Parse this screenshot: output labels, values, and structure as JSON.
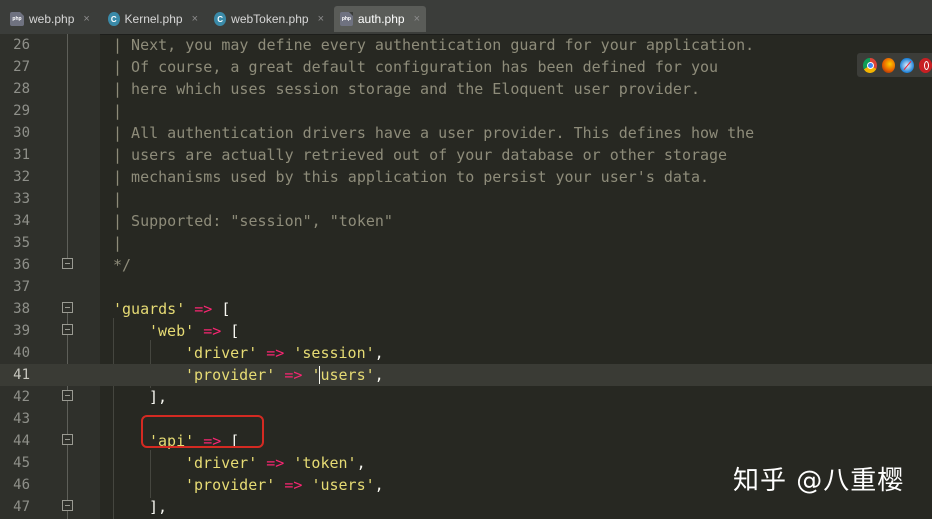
{
  "tabs": [
    {
      "name": "web.php",
      "icon": "php-file-icon",
      "active": false
    },
    {
      "name": "Kernel.php",
      "icon": "class-file-icon",
      "active": false
    },
    {
      "name": "webToken.php",
      "icon": "class-file-icon",
      "active": false
    },
    {
      "name": "auth.php",
      "icon": "php-file-icon",
      "active": true
    }
  ],
  "tab_close_glyph": "×",
  "editor": {
    "current_line": "41",
    "lines": [
      {
        "num": "26",
        "text": "| Next, you may define every authentication guard for your application."
      },
      {
        "num": "27",
        "text": "| Of course, a great default configuration has been defined for you"
      },
      {
        "num": "28",
        "text": "| here which uses session storage and the Eloquent user provider."
      },
      {
        "num": "29",
        "text": "|"
      },
      {
        "num": "30",
        "text": "| All authentication drivers have a user provider. This defines how the"
      },
      {
        "num": "31",
        "text": "| users are actually retrieved out of your database or other storage"
      },
      {
        "num": "32",
        "text": "| mechanisms used by this application to persist your user's data."
      },
      {
        "num": "33",
        "text": "|"
      },
      {
        "num": "34",
        "text": "| Supported: \"session\", \"token\""
      },
      {
        "num": "35",
        "text": "|"
      },
      {
        "num": "36",
        "text": "*/"
      },
      {
        "num": "37",
        "text": ""
      },
      {
        "num": "38",
        "key": "'guards'",
        "op": "=>",
        "tail": "["
      },
      {
        "num": "39",
        "key": "'web'",
        "op": "=>",
        "tail": "["
      },
      {
        "num": "40",
        "key": "'driver'",
        "op": "=>",
        "val": "'session'",
        "tail": ","
      },
      {
        "num": "41",
        "key": "'provider'",
        "op": "=>",
        "val": "'users'",
        "tail": ","
      },
      {
        "num": "42",
        "tail": "],"
      },
      {
        "num": "43",
        "text": ""
      },
      {
        "num": "44",
        "key": "'api'",
        "op": "=>",
        "tail": "["
      },
      {
        "num": "45",
        "key": "'driver'",
        "op": "=>",
        "val": "'token'",
        "tail": ","
      },
      {
        "num": "46",
        "key": "'provider'",
        "op": "=>",
        "val": "'users'",
        "tail": ","
      },
      {
        "num": "47",
        "tail": "],"
      }
    ]
  },
  "browser_icons": [
    "chrome-icon",
    "firefox-icon",
    "safari-icon",
    "opera-icon"
  ],
  "watermark": "知乎 @八重樱",
  "colors": {
    "background": "#272822",
    "comment": "#8e8c7a",
    "string": "#e6db74",
    "operator": "#f92672",
    "highlight_box": "#d42a22"
  }
}
